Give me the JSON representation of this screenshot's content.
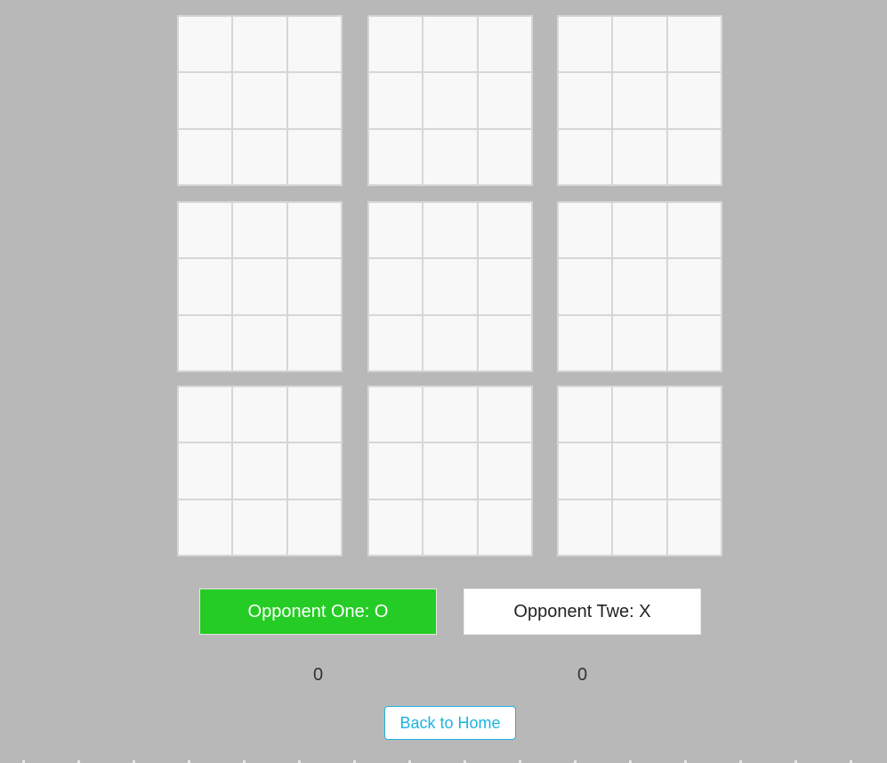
{
  "board": {
    "sub_boards": [
      [
        "",
        "",
        "",
        "",
        "",
        "",
        "",
        "",
        ""
      ],
      [
        "",
        "",
        "",
        "",
        "",
        "",
        "",
        "",
        ""
      ],
      [
        "",
        "",
        "",
        "",
        "",
        "",
        "",
        "",
        ""
      ],
      [
        "",
        "",
        "",
        "",
        "",
        "",
        "",
        "",
        ""
      ],
      [
        "",
        "",
        "",
        "",
        "",
        "",
        "",
        "",
        ""
      ],
      [
        "",
        "",
        "",
        "",
        "",
        "",
        "",
        "",
        ""
      ],
      [
        "",
        "",
        "",
        "",
        "",
        "",
        "",
        "",
        ""
      ],
      [
        "",
        "",
        "",
        "",
        "",
        "",
        "",
        "",
        ""
      ],
      [
        "",
        "",
        "",
        "",
        "",
        "",
        "",
        "",
        ""
      ]
    ]
  },
  "players": {
    "one": {
      "label": "Opponent One: O",
      "score": "0",
      "active": true
    },
    "two": {
      "label": "Opponent Twe: X",
      "score": "0",
      "active": false
    }
  },
  "actions": {
    "back_label": "Back to Home"
  },
  "colors": {
    "background": "#b8b8b8",
    "active_player": "#25cc25",
    "inactive_player": "#ffffff",
    "link_accent": "#1cb5e0",
    "cell_fill": "#f8f8f8",
    "grid_line": "#d6d6d6"
  }
}
